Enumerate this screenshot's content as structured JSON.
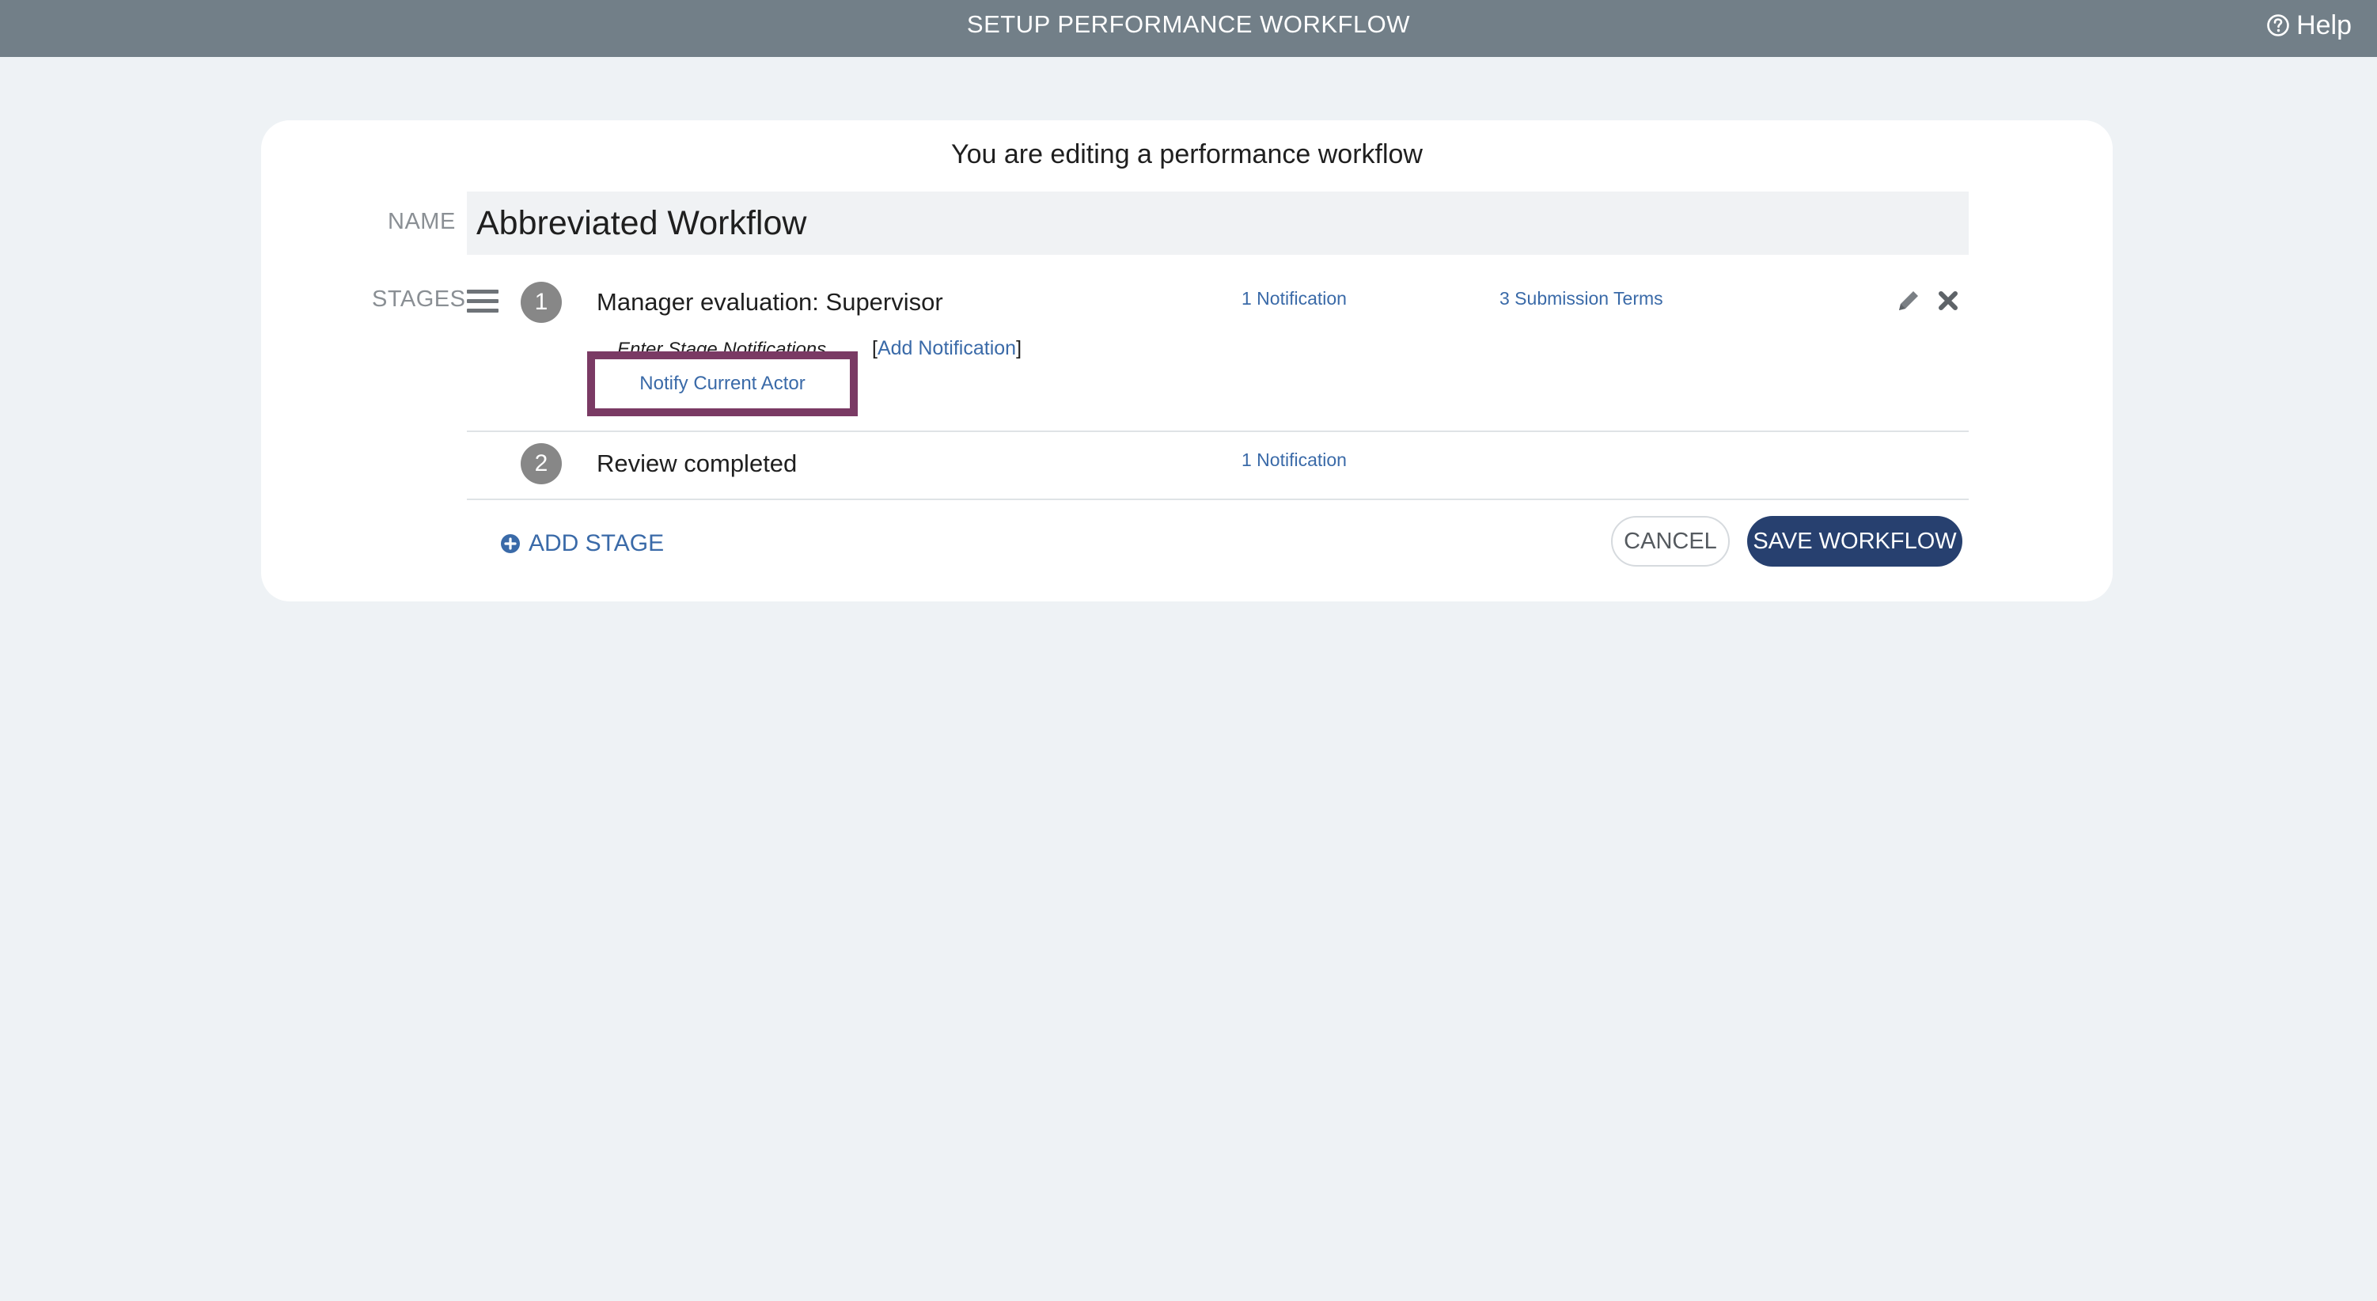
{
  "topbar": {
    "title": "SETUP PERFORMANCE WORKFLOW",
    "help_label": "Help"
  },
  "card": {
    "heading": "You are editing a performance workflow",
    "name_label": "NAME",
    "name_value": "Abbreviated Workflow",
    "stages_label": "STAGES"
  },
  "stages": [
    {
      "number": "1",
      "name": "Manager evaluation: Supervisor",
      "notifications_link": "1 Notification",
      "terms_link": "3 Submission Terms",
      "sub_label": "Enter Stage Notifications",
      "bracket_open": "[",
      "add_notification_link": "Add Notification",
      "bracket_close": "]",
      "notify_button": "Notify Current Actor"
    },
    {
      "number": "2",
      "name": "Review completed",
      "notifications_link": "1 Notification"
    }
  ],
  "footer": {
    "add_stage_label": "ADD STAGE",
    "cancel_label": "CANCEL",
    "save_label": "SAVE WORKFLOW"
  },
  "icons": {
    "help": "help-circle-icon",
    "drag": "hamburger-icon",
    "edit": "pencil-icon",
    "delete": "close-icon",
    "add": "plus-circle-icon"
  },
  "colors": {
    "topbar": "#727f88",
    "link": "#3a6aa8",
    "primary_button": "#27406f",
    "highlight": "#7a3a64",
    "badge": "#878787"
  }
}
